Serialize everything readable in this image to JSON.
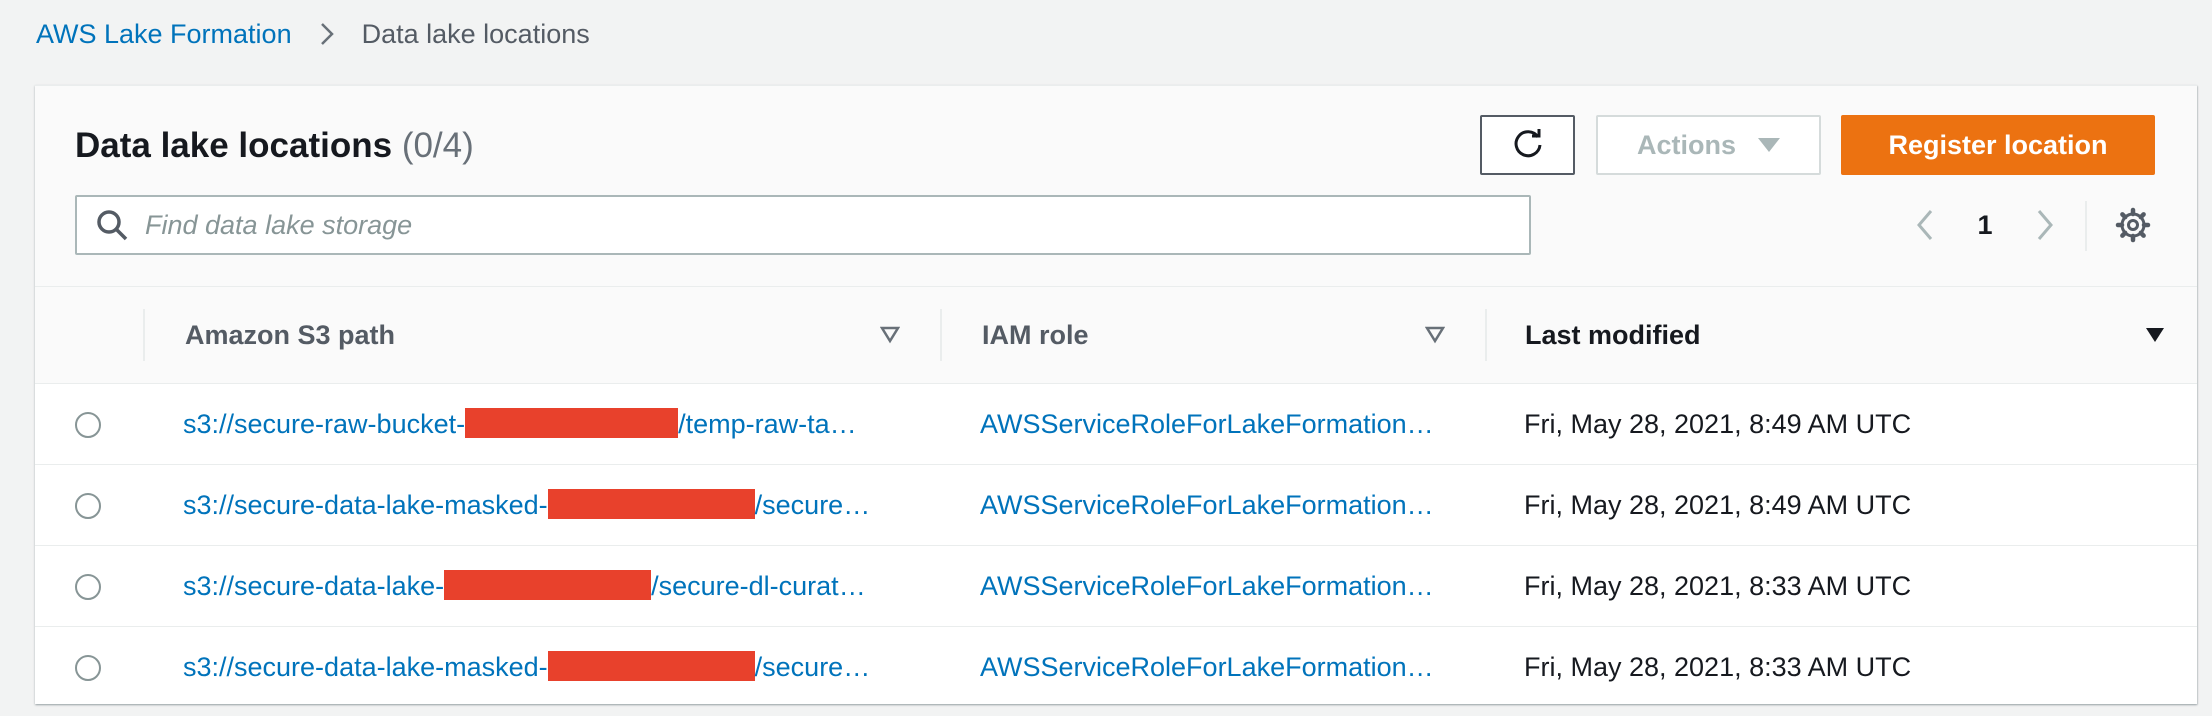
{
  "breadcrumb": {
    "root": "AWS Lake Formation",
    "current": "Data lake locations"
  },
  "panel": {
    "title": "Data lake locations",
    "count": "(0/4)"
  },
  "toolbar": {
    "refresh_icon": "refresh-icon",
    "actions_label": "Actions",
    "register_label": "Register location"
  },
  "search": {
    "placeholder": "Find data lake storage"
  },
  "pagination": {
    "current_page": "1"
  },
  "table": {
    "columns": [
      "Amazon S3 path",
      "IAM role",
      "Last modified"
    ],
    "rows": [
      {
        "path_prefix": "s3://secure-raw-bucket-",
        "path_suffix": "/temp-raw-ta…",
        "role": "AWSServiceRoleForLakeFormation…",
        "modified": "Fri, May 28, 2021, 8:49 AM UTC"
      },
      {
        "path_prefix": "s3://secure-data-lake-masked-",
        "path_suffix": "/secure…",
        "role": "AWSServiceRoleForLakeFormation…",
        "modified": "Fri, May 28, 2021, 8:49 AM UTC"
      },
      {
        "path_prefix": "s3://secure-data-lake-",
        "path_suffix": "/secure-dl-curat…",
        "role": "AWSServiceRoleForLakeFormation…",
        "modified": "Fri, May 28, 2021, 8:33 AM UTC"
      },
      {
        "path_prefix": "s3://secure-data-lake-masked-",
        "path_suffix": "/secure…",
        "role": "AWSServiceRoleForLakeFormation…",
        "modified": "Fri, May 28, 2021, 8:33 AM UTC"
      }
    ]
  },
  "colors": {
    "link": "#0073bb",
    "primary_button": "#ec7211",
    "redaction": "#e8412c"
  }
}
